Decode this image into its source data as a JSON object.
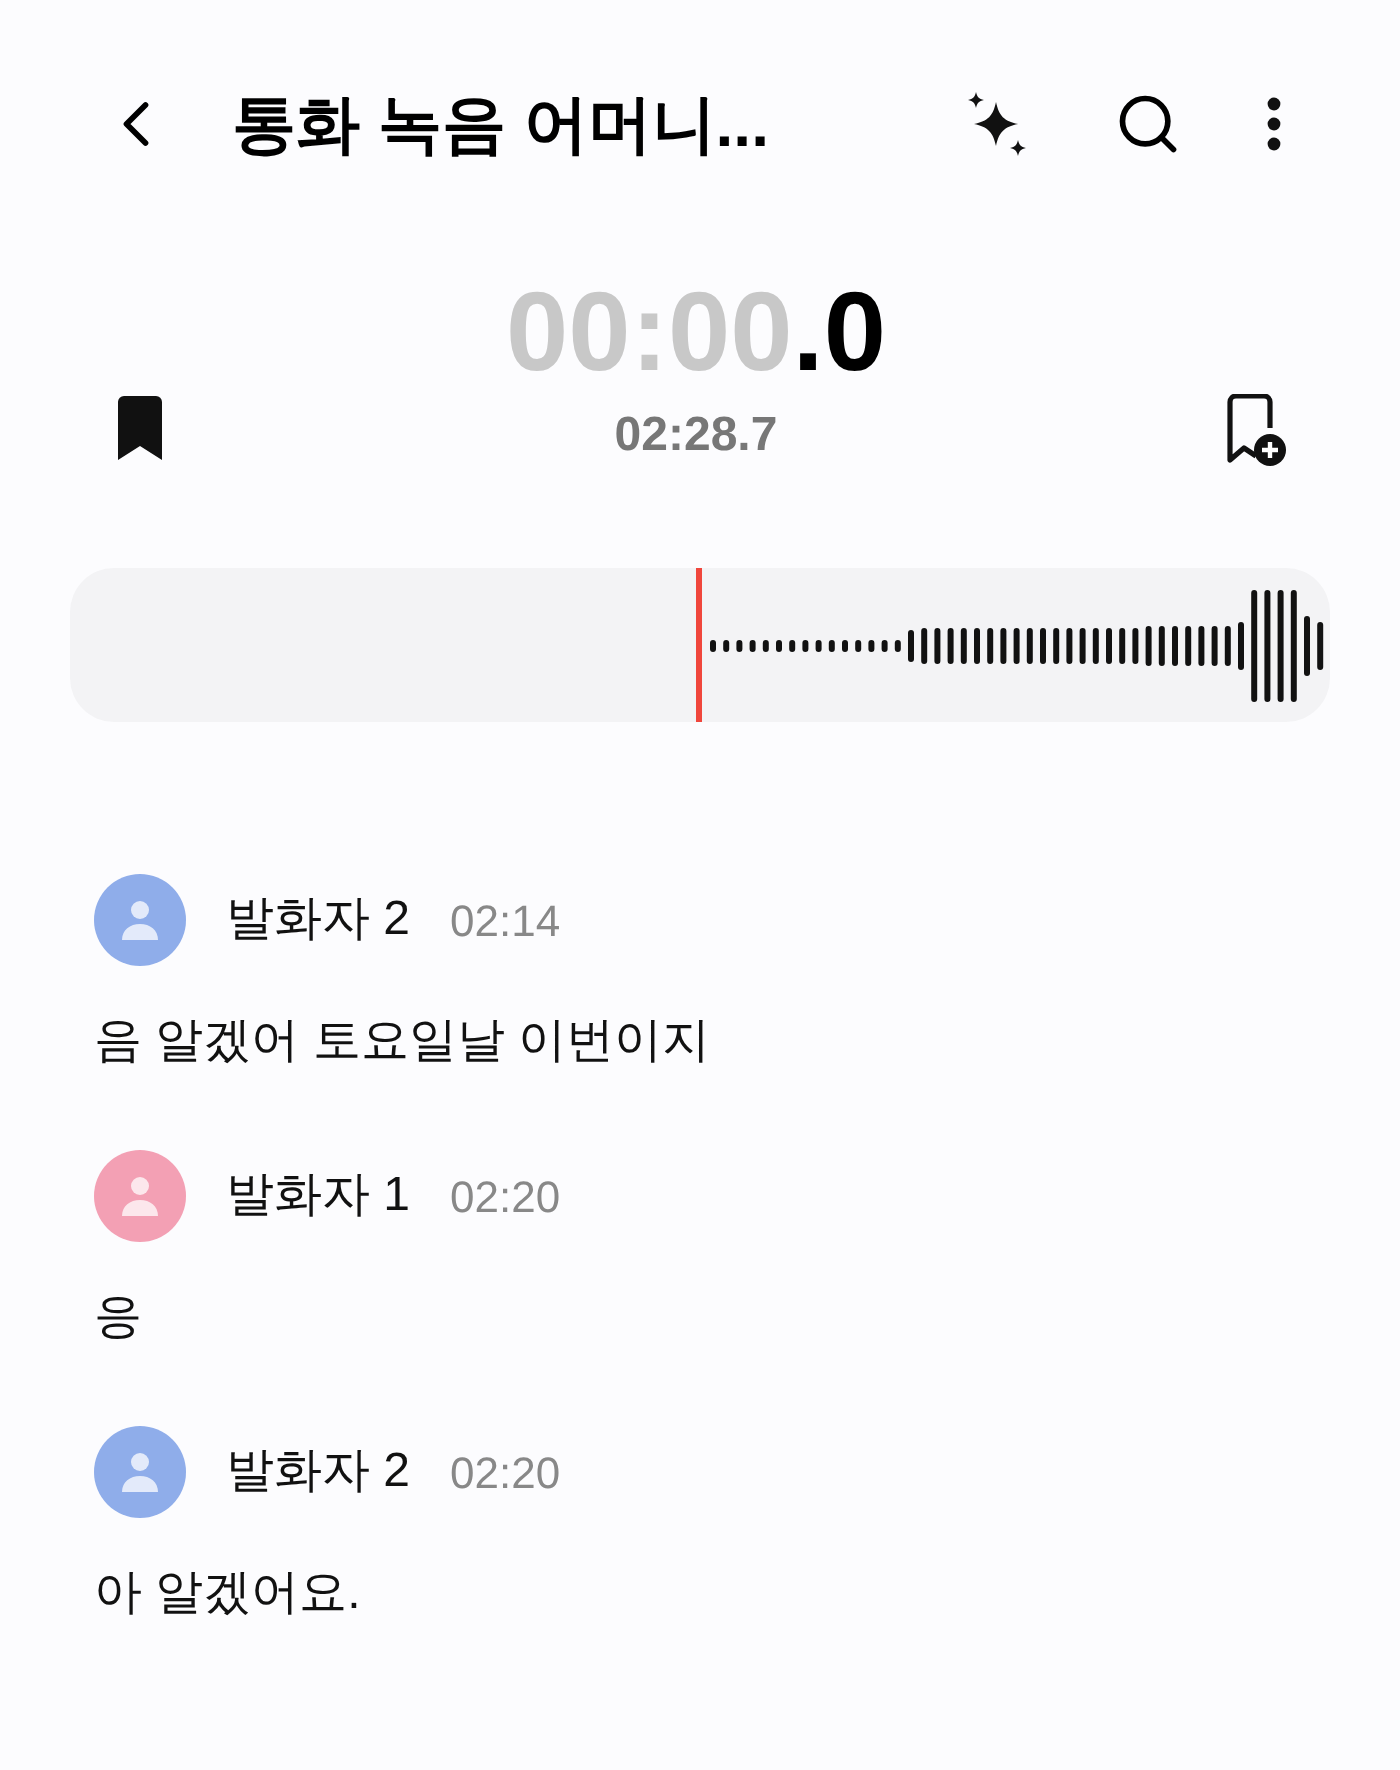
{
  "header": {
    "title": "통화 녹음 어머니..."
  },
  "timer": {
    "elapsed_dim": "00:00",
    "elapsed_tenths": ".0",
    "total": "02:28.7"
  },
  "transcript": [
    {
      "speaker": "발화자 2",
      "time": "02:14",
      "color": "#8fadea",
      "text": "음 알겠어 토요일날 이번이지"
    },
    {
      "speaker": "발화자 1",
      "time": "02:20",
      "color": "#f3a0b4",
      "text": "응"
    },
    {
      "speaker": "발화자 2",
      "time": "02:20",
      "color": "#8fadea",
      "text": "아 알겠어요."
    }
  ]
}
